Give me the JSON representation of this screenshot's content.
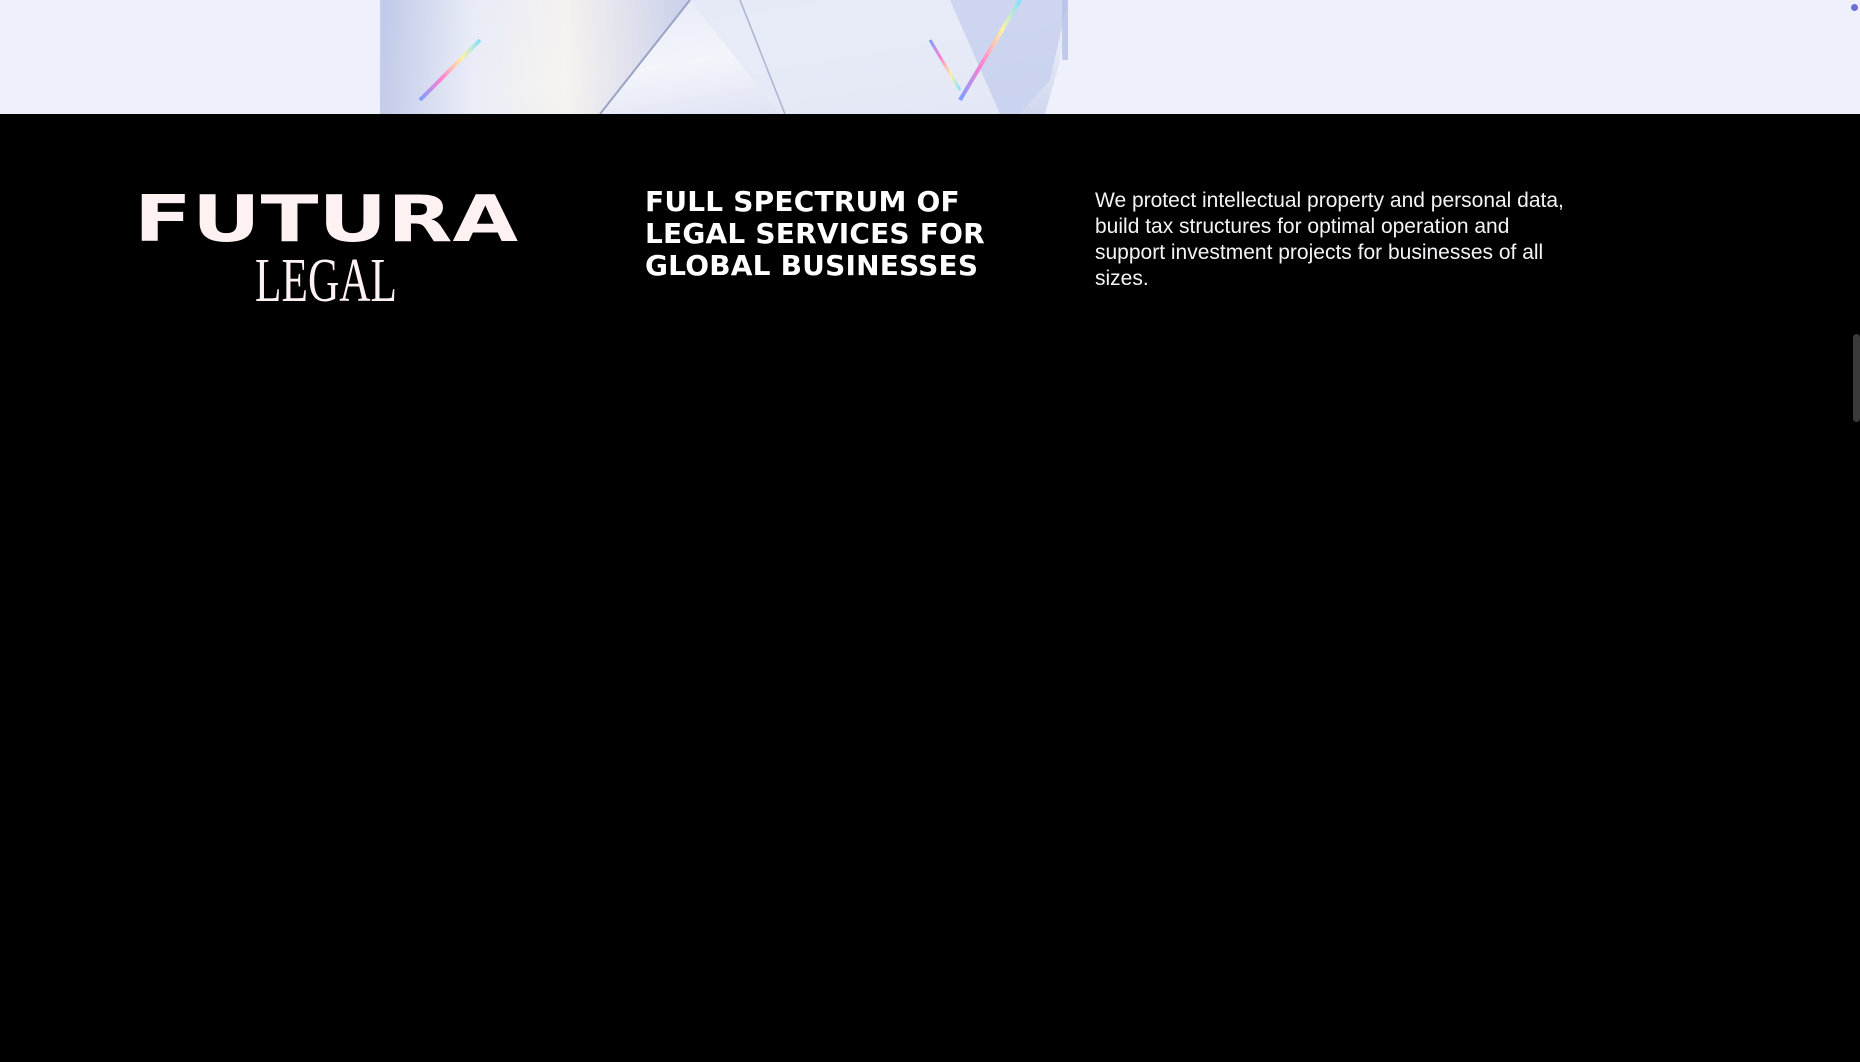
{
  "hero": {
    "image_icon": "crystal-prism-image"
  },
  "footer": {
    "logo": {
      "line1": "FUTURA",
      "line2": "LEGAL",
      "color": "#fdf1f2"
    },
    "tagline": "FULL SPECTRUM OF LEGAL SERVICES FOR GLOBAL BUSINESSES",
    "description": "We protect intellectual property and personal data, build tax structures for optimal operation and support investment projects for businesses of all sizes."
  },
  "colors": {
    "footer_background": "#000000",
    "hero_background": "#eef1fb",
    "text": "#ffffff"
  }
}
